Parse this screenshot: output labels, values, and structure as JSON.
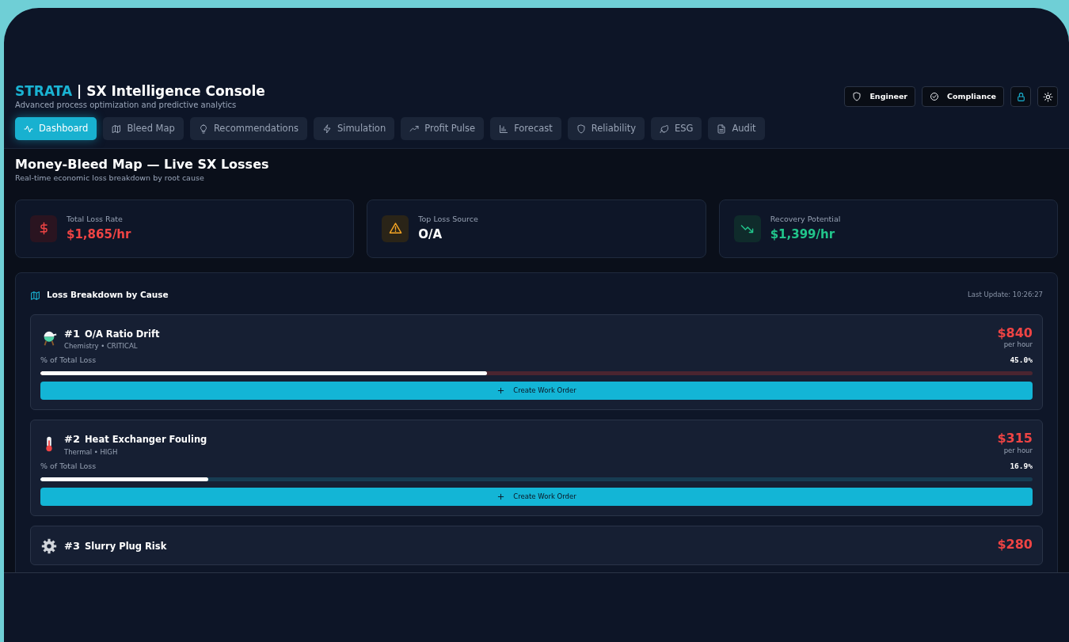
{
  "header": {
    "brand": "STRATA",
    "title": "| SX Intelligence Console",
    "subtitle": "Advanced process optimization and predictive analytics",
    "role_buttons": [
      {
        "label": "Engineer"
      },
      {
        "label": "Compliance"
      }
    ]
  },
  "tabs": [
    {
      "label": "Dashboard",
      "selected": true
    },
    {
      "label": "Bleed Map",
      "selected": false
    },
    {
      "label": "Recommendations",
      "selected": false
    },
    {
      "label": "Simulation",
      "selected": false
    },
    {
      "label": "Profit Pulse",
      "selected": false
    },
    {
      "label": "Forecast",
      "selected": false
    },
    {
      "label": "Reliability",
      "selected": false
    },
    {
      "label": "ESG",
      "selected": false
    },
    {
      "label": "Audit",
      "selected": false
    }
  ],
  "page": {
    "title": "Money-Bleed Map — Live SX Losses",
    "subtitle": "Real-time economic loss breakdown by root cause"
  },
  "stats": [
    {
      "label": "Total Loss Rate",
      "value": "$1,865/hr",
      "kind": "loss"
    },
    {
      "label": "Top Loss Source",
      "value": "O/A",
      "kind": "warning"
    },
    {
      "label": "Recovery Potential",
      "value": "$1,399/hr",
      "kind": "recovery"
    }
  ],
  "breakdown": {
    "title": "Loss Breakdown by Cause",
    "last_update": "Last Update: 10:26:27",
    "items": [
      {
        "rank": "#1",
        "name": "O/A Ratio Drift",
        "kind": "chemistry",
        "meta": "Chemistry • CRITICAL",
        "amount": "$840",
        "unit": "per hour",
        "share_label": "% of Total Loss",
        "share": "45.0%",
        "level": 0.45,
        "action": "Create Work Order"
      },
      {
        "rank": "#2",
        "name": "Heat Exchanger Fouling",
        "kind": "thermal",
        "meta": "Thermal • HIGH",
        "amount": "$315",
        "unit": "per hour",
        "share_label": "% of Total Loss",
        "share": "16.9%",
        "level": 0.169,
        "action": "Create Work Order"
      },
      {
        "rank": "#3",
        "name": "Slurry Plug Risk",
        "kind": "mechanical",
        "amount": "$280"
      }
    ]
  }
}
